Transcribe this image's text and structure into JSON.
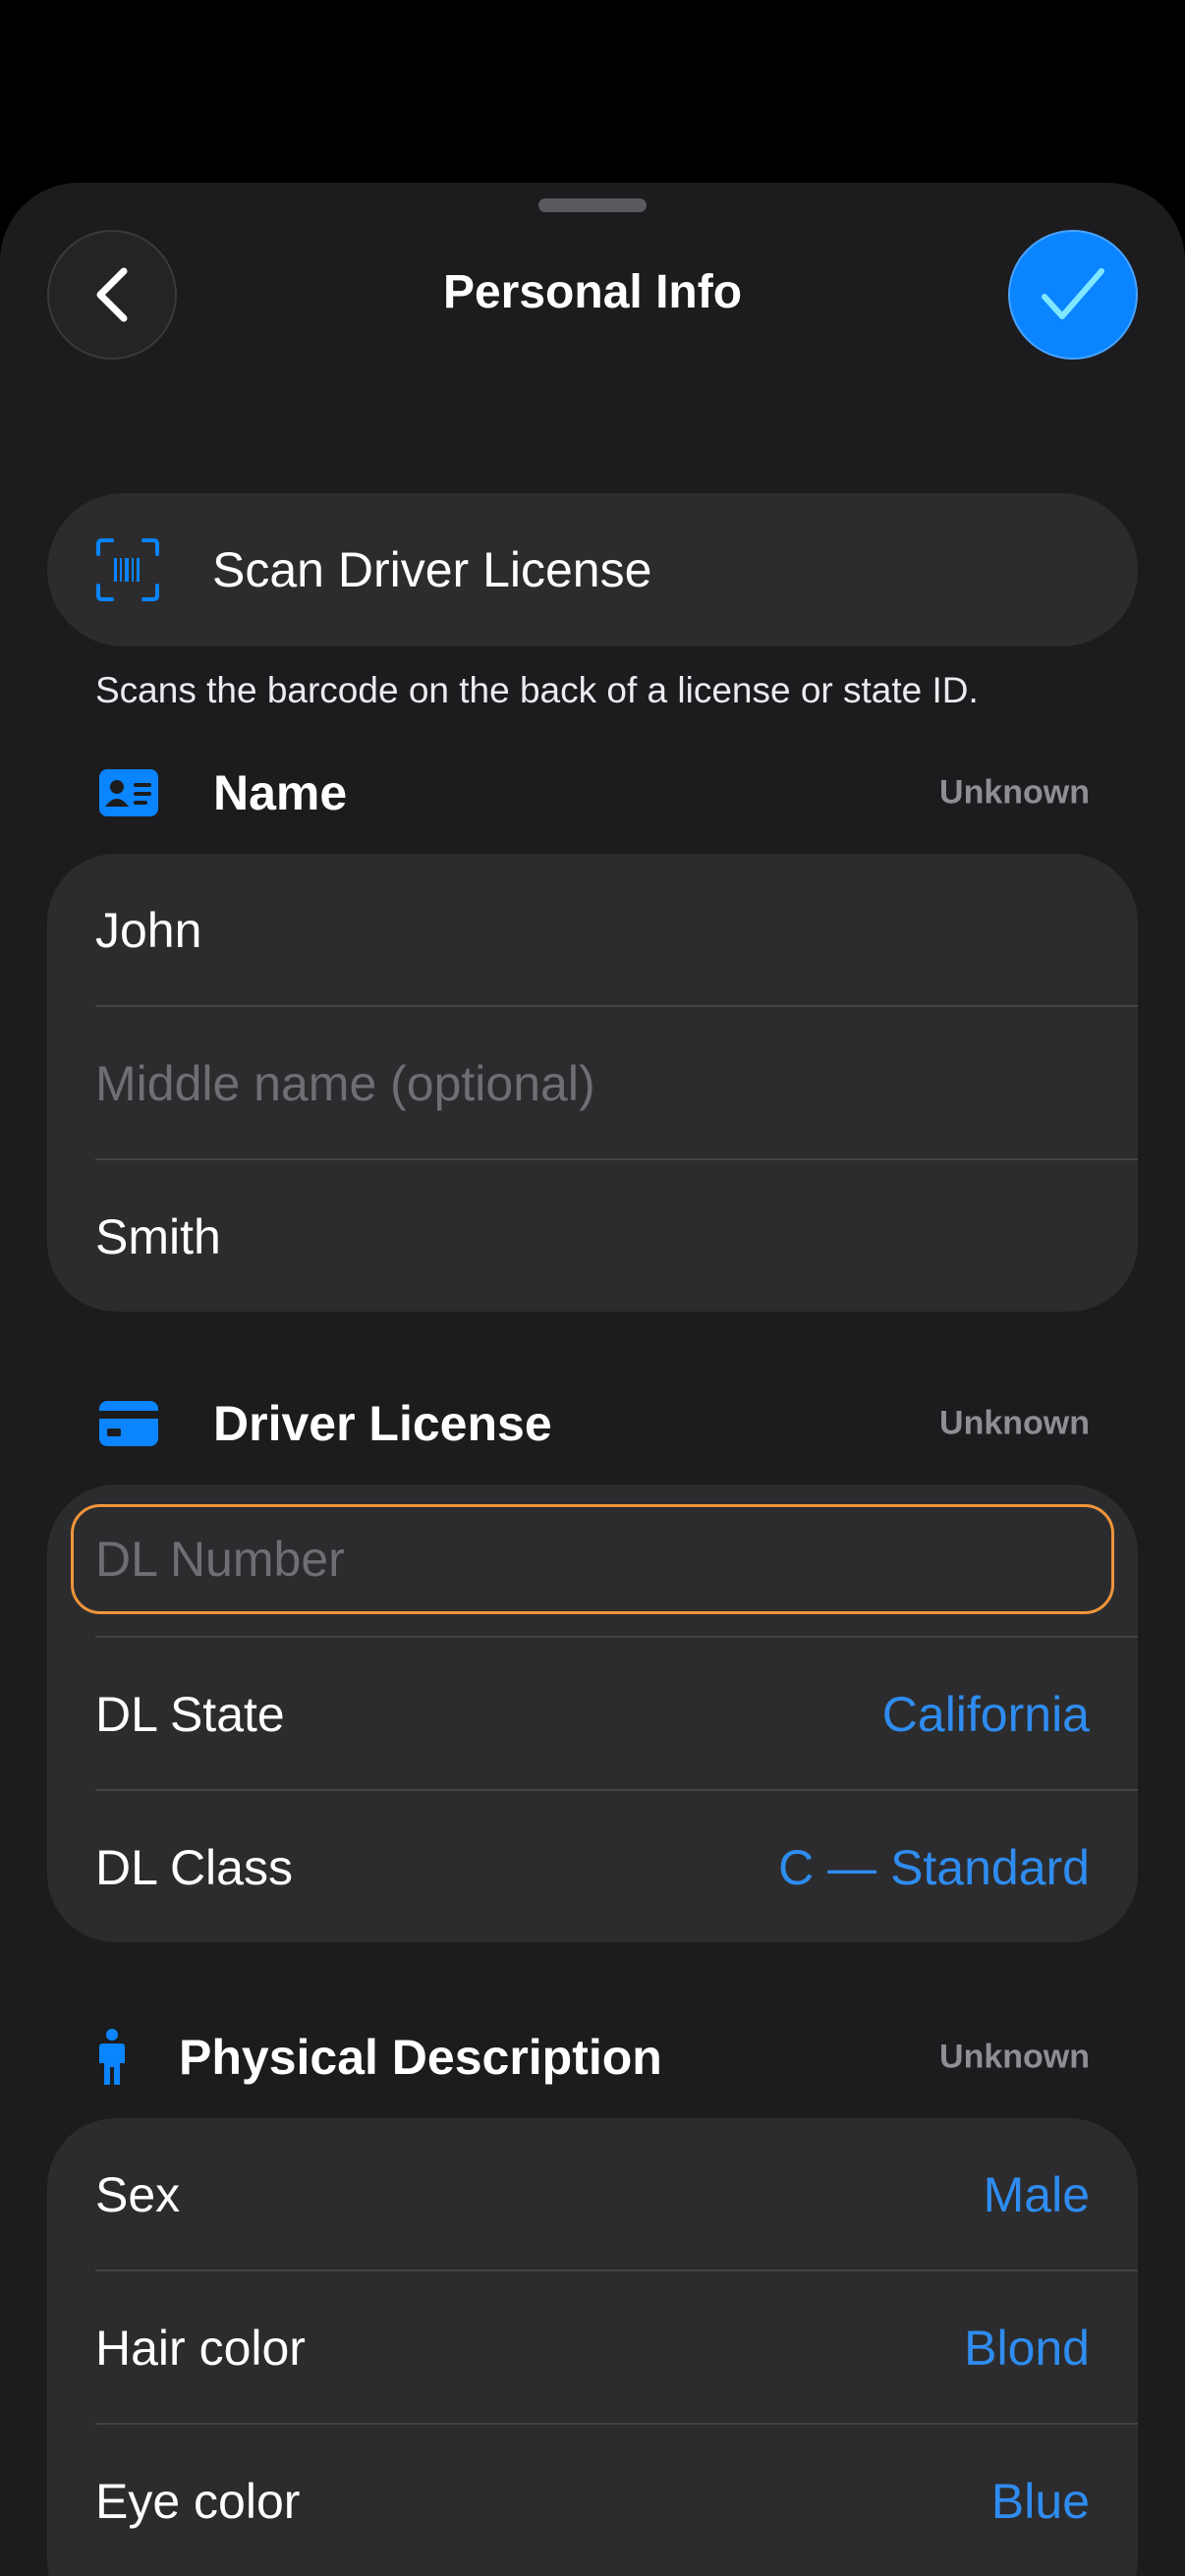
{
  "header": {
    "title": "Personal Info",
    "back_icon": "chevron-left-icon",
    "confirm_icon": "checkmark-icon"
  },
  "scan": {
    "label": "Scan Driver License",
    "icon": "barcode-scan-icon",
    "note": "Scans the barcode on the back of a license or state ID."
  },
  "name_section": {
    "title": "Name",
    "status": "Unknown",
    "icon": "id-card-icon",
    "first_name": "John",
    "middle_placeholder": "Middle name (optional)",
    "last_name": "Smith"
  },
  "license_section": {
    "title": "Driver License",
    "status": "Unknown",
    "icon": "credit-card-icon",
    "number_placeholder": "DL Number",
    "state_label": "DL State",
    "state_value": "California",
    "class_label": "DL Class",
    "class_value": "C — Standard"
  },
  "physical_section": {
    "title": "Physical Description",
    "status": "Unknown",
    "icon": "person-icon",
    "sex_label": "Sex",
    "sex_value": "Male",
    "hair_label": "Hair color",
    "hair_value": "Blond",
    "eye_label": "Eye color",
    "eye_value": "Blue"
  },
  "colors": {
    "accent": "#0a84ff",
    "value_text": "#2f8cf0",
    "focus_border": "#f0953a",
    "card_bg": "#2c2c2e",
    "sheet_bg": "#1c1c1e"
  }
}
